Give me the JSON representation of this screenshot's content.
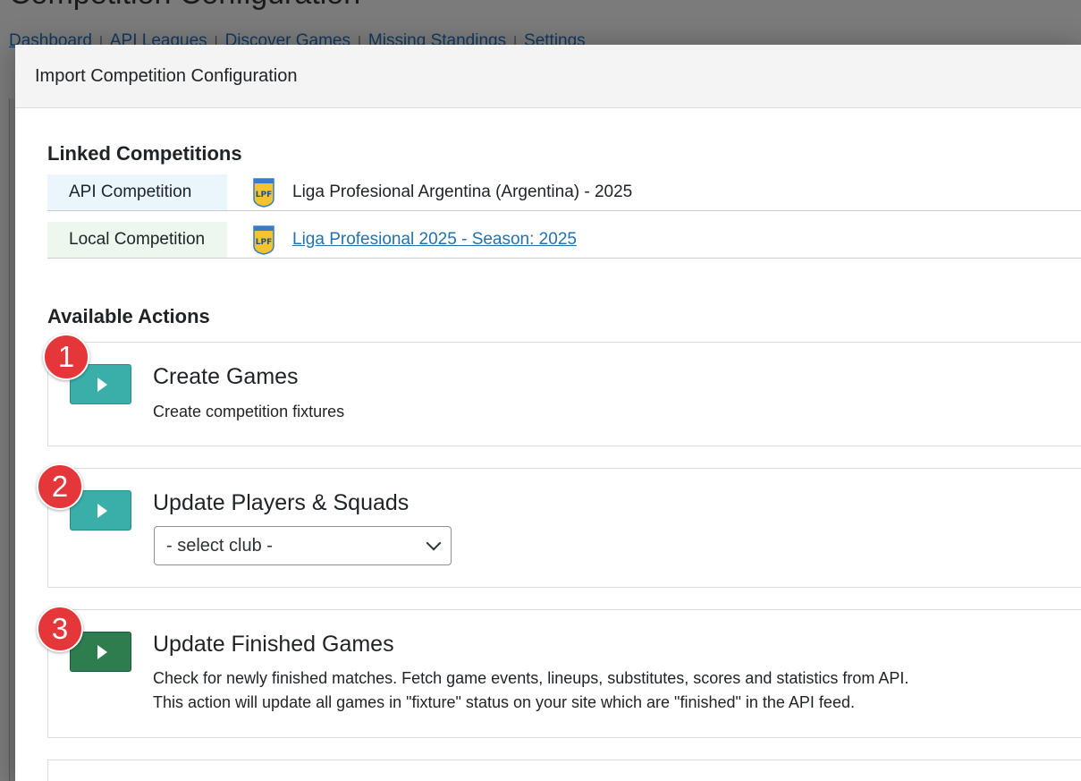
{
  "background": {
    "title": "Competition Configuration",
    "nav": [
      "Dashboard",
      "API Leagues",
      "Discover Games",
      "Missing Standings",
      "Settings"
    ]
  },
  "modal": {
    "title": "Import Competition Configuration"
  },
  "linked": {
    "heading": "Linked Competitions",
    "api_label": "API Competition",
    "api_value": "Liga Profesional Argentina (Argentina) - 2025",
    "local_label": "Local Competition",
    "local_value": "Liga Profesional 2025 - Season: 2025",
    "logo_text": "LPF"
  },
  "actions": {
    "heading": "Available Actions",
    "items": [
      {
        "number": "1",
        "title": "Create Games",
        "desc": "Create competition fixtures"
      },
      {
        "number": "2",
        "title": "Update Players & Squads",
        "select_value": "- select club -"
      },
      {
        "number": "3",
        "title": "Update Finished Games",
        "desc_line1": "Check for newly finished matches. Fetch game events, lineups, substitutes, scores and statistics from API.",
        "desc_line2": "This action will update all games in \"fixture\" status on your site which are \"finished\" in the API feed."
      }
    ]
  },
  "colors": {
    "teal_button": "#3aafa9",
    "green_button": "#2e7d4f",
    "badge": "#e5373a",
    "link": "#2271b1"
  }
}
